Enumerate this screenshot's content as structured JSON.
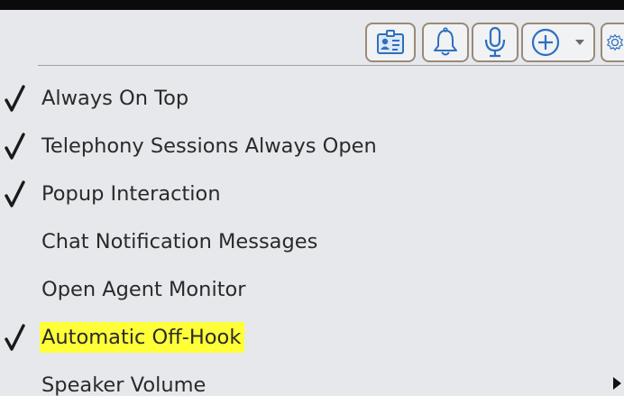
{
  "toolbar": {
    "buttons": [
      {
        "icon": "contact-card-icon"
      },
      {
        "icon": "bell-icon"
      },
      {
        "icon": "microphone-icon"
      },
      {
        "icon": "plus-circle-icon",
        "has_dropdown": true
      },
      {
        "icon": "gear-icon"
      }
    ]
  },
  "menu": {
    "items": [
      {
        "label": "Always On Top",
        "checked": true,
        "highlighted": false,
        "submenu": false
      },
      {
        "label": "Telephony Sessions Always Open",
        "checked": true,
        "highlighted": false,
        "submenu": false
      },
      {
        "label": "Popup Interaction",
        "checked": true,
        "highlighted": false,
        "submenu": false
      },
      {
        "label": "Chat Notification Messages",
        "checked": false,
        "highlighted": false,
        "submenu": false
      },
      {
        "label": "Open Agent Monitor",
        "checked": false,
        "highlighted": false,
        "submenu": false
      },
      {
        "label": "Automatic Off-Hook",
        "checked": true,
        "highlighted": true,
        "submenu": false
      },
      {
        "label": "Speaker Volume",
        "checked": false,
        "highlighted": false,
        "submenu": true
      }
    ]
  },
  "colors": {
    "background": "#e6e8eb",
    "highlight": "#ffff39",
    "button_border": "#9a8a78",
    "icon_blue": "#2f6fbf"
  }
}
